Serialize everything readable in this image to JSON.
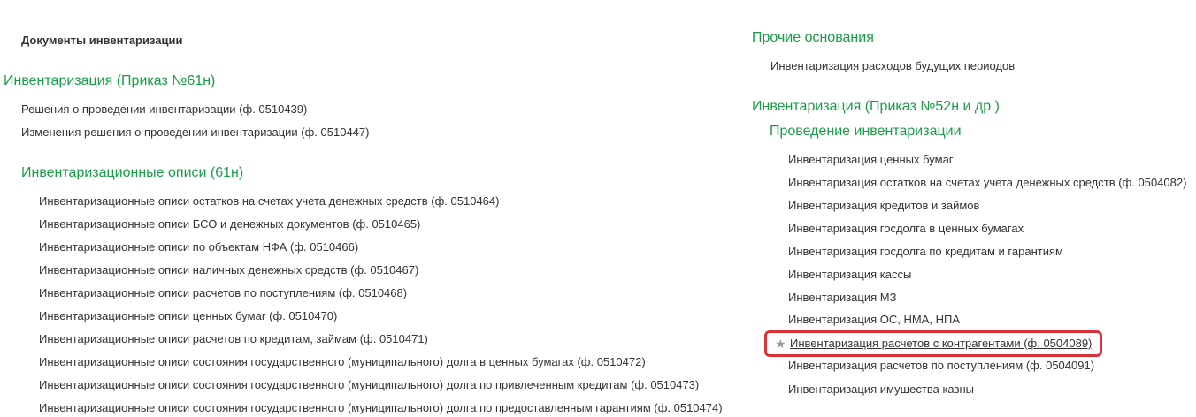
{
  "left": {
    "section_title": "Документы инвентаризации",
    "group_61n": {
      "title": "Инвентаризация (Приказ №61н)",
      "items": [
        "Решения о проведении инвентаризации (ф. 0510439)",
        "Изменения решения о проведении инвентаризации (ф. 0510447)"
      ]
    },
    "subgroup_opisi": {
      "title": "Инвентаризационные описи (61н)",
      "items": [
        "Инвентаризационные описи остатков на счетах учета денежных средств (ф. 0510464)",
        "Инвентаризационные описи БСО и денежных документов (ф. 0510465)",
        "Инвентаризационные описи по объектам НФА (ф. 0510466)",
        "Инвентаризационные описи наличных денежных средств (ф. 0510467)",
        "Инвентаризационные описи расчетов по поступлениям (ф. 0510468)",
        "Инвентаризационные описи ценных бумаг (ф. 0510470)",
        "Инвентаризационные описи расчетов по кредитам, займам (ф. 0510471)",
        "Инвентаризационные описи состояния государственного (муниципального) долга в ценных бумагах (ф. 0510472)",
        "Инвентаризационные описи состояния государственного (муниципального) долга по привлеченным кредитам (ф. 0510473)",
        "Инвентаризационные описи состояния государственного (муниципального) долга по предоставленным гарантиям (ф. 0510474)"
      ]
    }
  },
  "right": {
    "group_other": {
      "title": "Прочие основания",
      "items": [
        "Инвентаризация расходов будущих периодов"
      ]
    },
    "group_52n": {
      "title": "Инвентаризация (Приказ №52н и др.)",
      "subgroup_title": "Проведение инвентаризации",
      "items": [
        "Инвентаризация ценных бумаг",
        "Инвентаризация остатков на счетах учета денежных средств (ф. 0504082)",
        "Инвентаризация кредитов и займов",
        "Инвентаризация госдолга в ценных бумагах",
        "Инвентаризация госдолга по кредитам и гарантиям",
        "Инвентаризация кассы",
        "Инвентаризация МЗ",
        "Инвентаризация ОС, НМА, НПА"
      ],
      "highlighted_item": "Инвентаризация расчетов с контрагентами (ф. 0504089)",
      "highlight_color": "#d9323a",
      "after_items": [
        "Инвентаризация расчетов по поступлениям (ф. 0504091)",
        "Инвентаризация имущества казны"
      ]
    }
  },
  "colors": {
    "group_title": "#1a9d49",
    "text": "#333333",
    "star": "#9a9a9a"
  },
  "icons": {
    "favorite": "star-icon"
  }
}
